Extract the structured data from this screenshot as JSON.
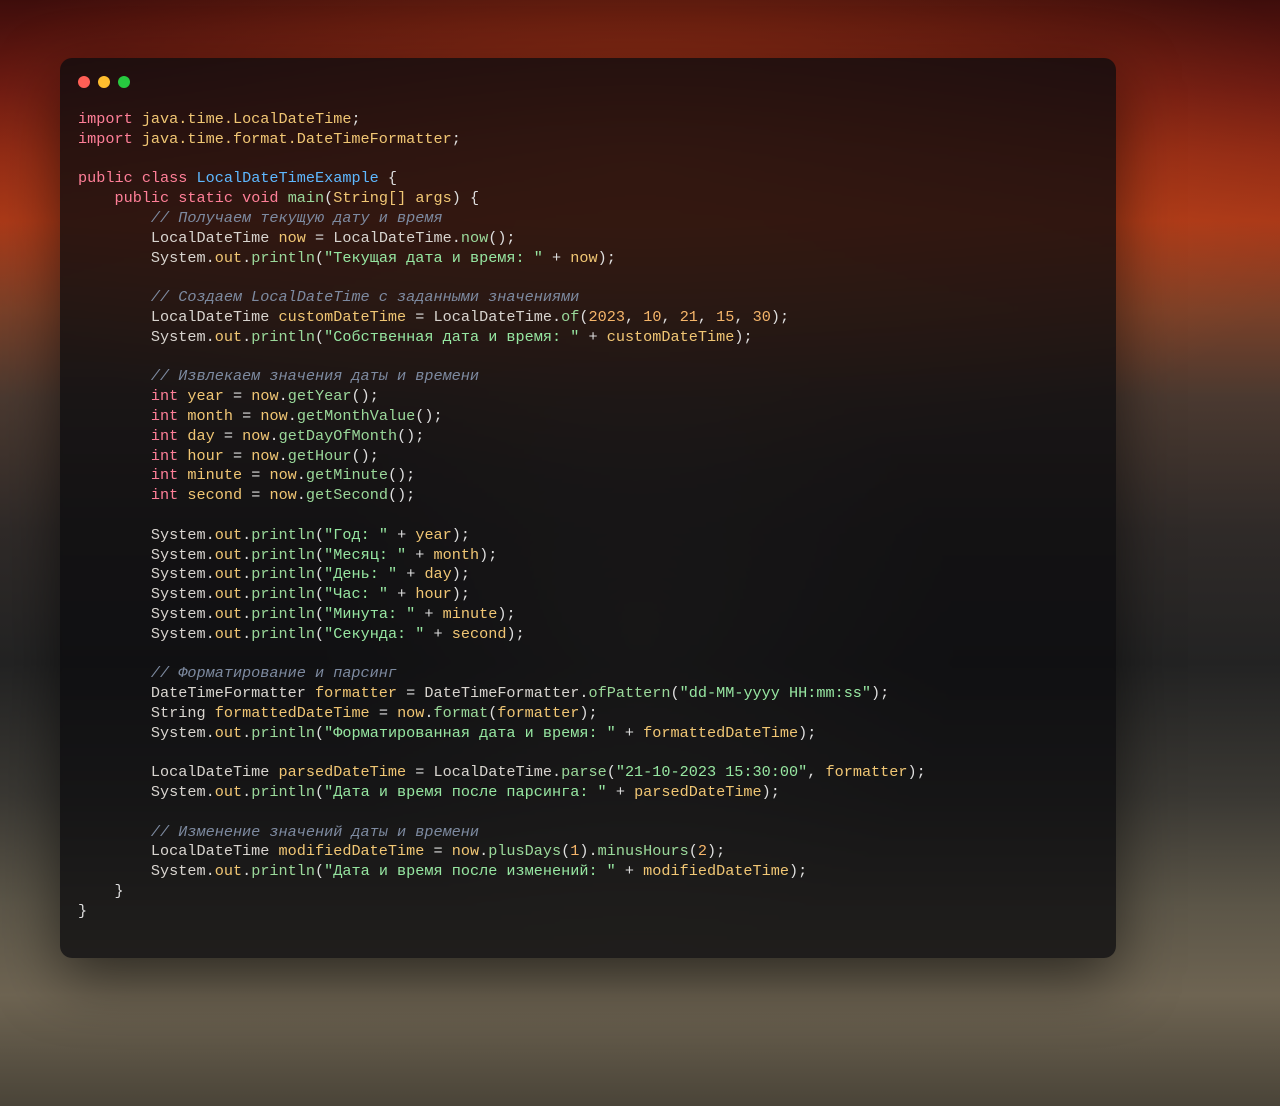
{
  "code": {
    "kw_import": "import",
    "kw_public": "public",
    "kw_class": "class",
    "kw_static": "static",
    "kw_void": "void",
    "kw_int": "int",
    "pkg1": "java.time.LocalDateTime",
    "pkg2": "java.time.format.DateTimeFormatter",
    "class_name": "LocalDateTimeExample",
    "main": "main",
    "type_string_arr": "String[]",
    "arg": "args",
    "cmt1": "// Получаем текущую дату и время",
    "t_ldt": "LocalDateTime",
    "v_now": "now",
    "m_now": "now",
    "t_sys": "System",
    "m_out": "out",
    "m_println": "println",
    "s1": "\"Текущая дата и время: \"",
    "cmt2": "// Создаем LocalDateTime с заданными значениями",
    "v_custom": "customDateTime",
    "m_of": "of",
    "n_2023": "2023",
    "n_10": "10",
    "n_21": "21",
    "n_15": "15",
    "n_30": "30",
    "s2": "\"Собственная дата и время: \"",
    "cmt3": "// Извлекаем значения даты и времени",
    "v_year": "year",
    "m_getYear": "getYear",
    "v_month": "month",
    "m_getMonthValue": "getMonthValue",
    "v_day": "day",
    "m_getDayOfMonth": "getDayOfMonth",
    "v_hour": "hour",
    "m_getHour": "getHour",
    "v_minute": "minute",
    "m_getMinute": "getMinute",
    "v_second": "second",
    "m_getSecond": "getSecond",
    "s_year": "\"Год: \"",
    "s_month": "\"Месяц: \"",
    "s_day": "\"День: \"",
    "s_hour": "\"Час: \"",
    "s_minute": "\"Минута: \"",
    "s_second": "\"Секунда: \"",
    "cmt4": "// Форматирование и парсинг",
    "t_dtf": "DateTimeFormatter",
    "v_formatter": "formatter",
    "m_ofPattern": "ofPattern",
    "s_pattern": "\"dd-MM-yyyy HH:mm:ss\"",
    "t_string": "String",
    "v_formatted": "formattedDateTime",
    "m_format": "format",
    "s_formatted": "\"Форматированная дата и время: \"",
    "v_parsed": "parsedDateTime",
    "m_parse": "parse",
    "s_parse_in": "\"21-10-2023 15:30:00\"",
    "s_parsed": "\"Дата и время после парсинга: \"",
    "cmt5": "// Изменение значений даты и времени",
    "v_modified": "modifiedDateTime",
    "m_plusDays": "plusDays",
    "n_1": "1",
    "m_minusHours": "minusHours",
    "n_2": "2",
    "s_modified": "\"Дата и время после изменений: \""
  }
}
